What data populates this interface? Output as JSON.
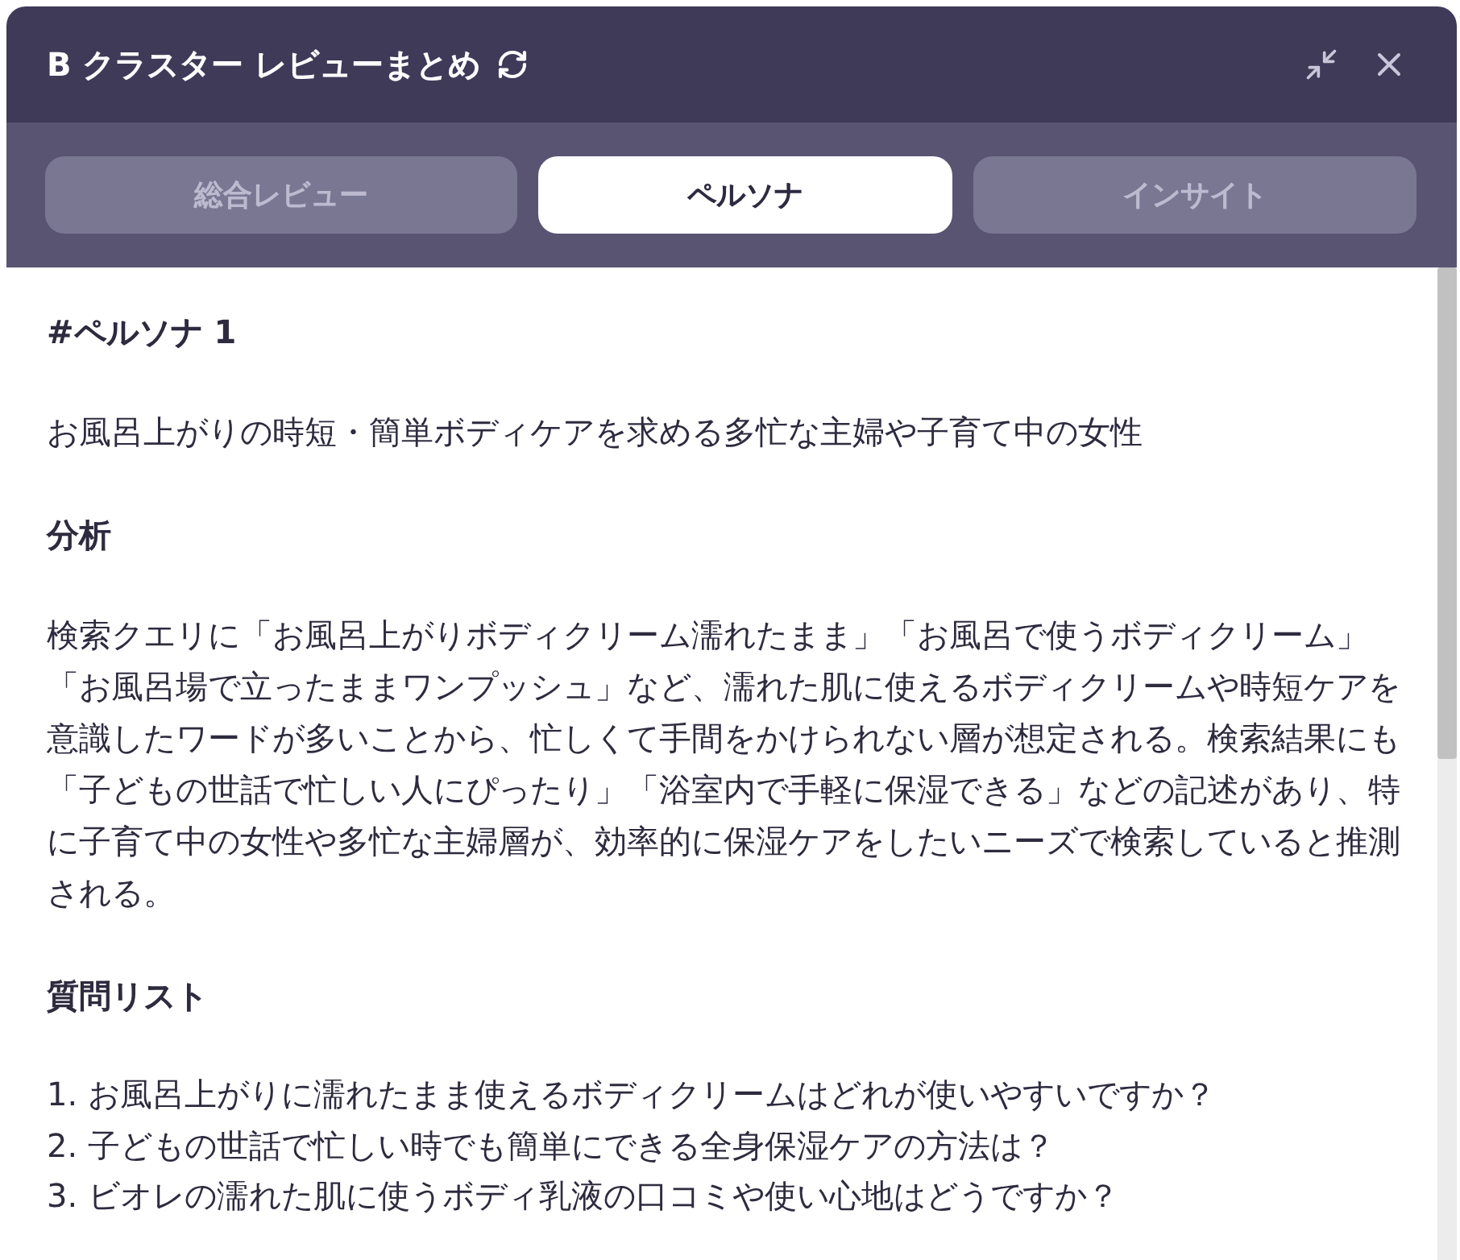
{
  "window": {
    "title": "B クラスター レビューまとめ"
  },
  "tabs": [
    {
      "label": "総合レビュー",
      "selected": false
    },
    {
      "label": "ペルソナ",
      "selected": true
    },
    {
      "label": "インサイト",
      "selected": false
    }
  ],
  "content": [
    {
      "kind": "heading",
      "text": "#ペルソナ 1"
    },
    {
      "kind": "paragraph",
      "text": "お風呂上がりの時短・簡単ボディケアを求める多忙な主婦や子育て中の女性"
    },
    {
      "kind": "heading",
      "text": "分析"
    },
    {
      "kind": "paragraph",
      "text": "検索クエリに「お風呂上がりボディクリーム濡れたまま」「お風呂で使うボディクリーム」「お風呂場で立ったままワンプッシュ」など、濡れた肌に使えるボディクリームや時短ケアを意識したワードが多いことから、忙しくて手間をかけられない層が想定される。検索結果にも「子どもの世話で忙しい人にぴったり」「浴室内で手軽に保湿できる」などの記述があり、特に子育て中の女性や多忙な主婦層が、効率的に保湿ケアをしたいニーズで検索していると推測される。"
    },
    {
      "kind": "heading",
      "text": "質問リスト"
    },
    {
      "kind": "list",
      "items": [
        "1. お風呂上がりに濡れたまま使えるボディクリームはどれが使いやすいですか？",
        "2. 子どもの世話で忙しい時でも簡単にできる全身保湿ケアの方法は？",
        "3. ビオレの濡れた肌に使うボディ乳液の口コミや使い心地はどうですか？"
      ]
    }
  ]
}
